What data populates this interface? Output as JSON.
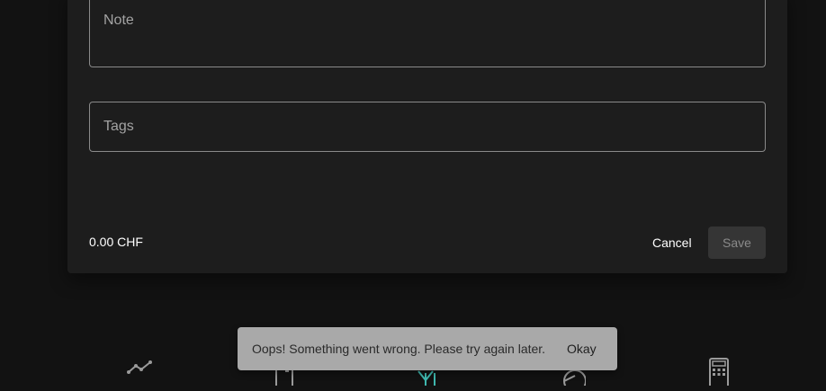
{
  "form": {
    "note_placeholder": "Note",
    "tags_placeholder": "Tags",
    "total": "0.00 CHF",
    "cancel_label": "Cancel",
    "save_label": "Save"
  },
  "bottom_nav": {
    "items": [
      {
        "icon": "trend-chart-icon"
      },
      {
        "icon": "wallet-icon"
      },
      {
        "icon": "transactions-icon",
        "active": true
      },
      {
        "icon": "pie-chart-icon"
      },
      {
        "icon": "calculator-icon"
      }
    ],
    "active_color": "#3fb8af"
  },
  "snackbar": {
    "message": "Oops! Something went wrong. Please try again later.",
    "action_label": "Okay"
  }
}
